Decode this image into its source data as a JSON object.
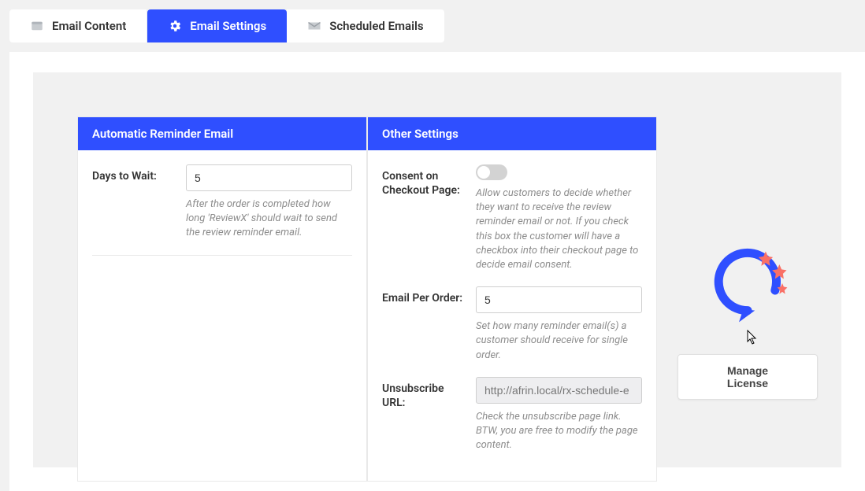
{
  "tabs": {
    "email_content": {
      "label": "Email Content"
    },
    "email_settings": {
      "label": "Email Settings"
    },
    "scheduled_emails": {
      "label": "Scheduled Emails"
    }
  },
  "panel_left": {
    "header": "Automatic Reminder Email",
    "days_to_wait": {
      "label": "Days to Wait:",
      "value": "5",
      "help": "After the order is completed how long 'ReviewX' should wait to send the review reminder email."
    }
  },
  "panel_right": {
    "header": "Other Settings",
    "consent": {
      "label": "Consent on Checkout Page:",
      "help": "Allow customers to decide whether they want to receive the review reminder email or not. If you check this box the customer will have a checkbox into their checkout page to decide email consent."
    },
    "email_per_order": {
      "label": "Email Per Order:",
      "value": "5",
      "help": "Set how many reminder email(s) a customer should receive for single order."
    },
    "unsubscribe": {
      "label": "Unsubscribe URL:",
      "value": "http://afrin.local/rx-schedule-email/",
      "placeholder": "http://afrin.local/rx-schedule-e",
      "help": "Check the unsubscribe page link. BTW, you are free to modify the page content."
    }
  },
  "side": {
    "manage_license": "Manage License"
  }
}
